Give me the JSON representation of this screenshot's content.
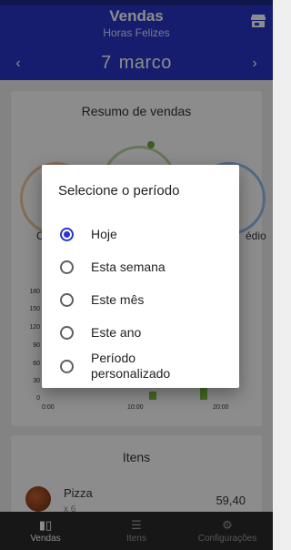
{
  "app_bar": {
    "title": "Vendas",
    "subtitle": "Horas Felizes",
    "store_icon": "store-icon",
    "prev_icon": "chevron-left-icon",
    "next_icon": "chevron-right-icon",
    "date_day": "7",
    "date_month": "marco"
  },
  "summary": {
    "title": "Resumo de vendas",
    "kpi_left_label": "C",
    "kpi_right_label": "édio",
    "chart_data": {
      "type": "bar",
      "y_ticks": [
        "180",
        "150",
        "120",
        "90",
        "60",
        "30",
        "0"
      ],
      "x_ticks": [
        "0:00",
        "10:00",
        "20:00"
      ],
      "ylim": [
        0,
        180
      ],
      "bar_color": "#7bc043"
    }
  },
  "items": {
    "title": "Itens",
    "list": [
      {
        "name": "Pizza",
        "qty": "x 6",
        "total": "59,40"
      }
    ]
  },
  "bottom_nav": {
    "tabs": [
      {
        "label": "Vendas",
        "icon": "bar-chart-icon",
        "active": true
      },
      {
        "label": "Itens",
        "icon": "list-icon",
        "active": false
      },
      {
        "label": "Configurações",
        "icon": "gear-icon",
        "active": false
      }
    ]
  },
  "dialog": {
    "title": "Selecione o período",
    "options": [
      {
        "label": "Hoje",
        "checked": true
      },
      {
        "label": "Esta semana",
        "checked": false
      },
      {
        "label": "Este mês",
        "checked": false
      },
      {
        "label": "Este ano",
        "checked": false
      },
      {
        "label_line1": "Período",
        "label_line2": "personalizado",
        "checked": false
      }
    ]
  },
  "colors": {
    "primary": "#2836c8",
    "accent_green": "#7bc043"
  }
}
